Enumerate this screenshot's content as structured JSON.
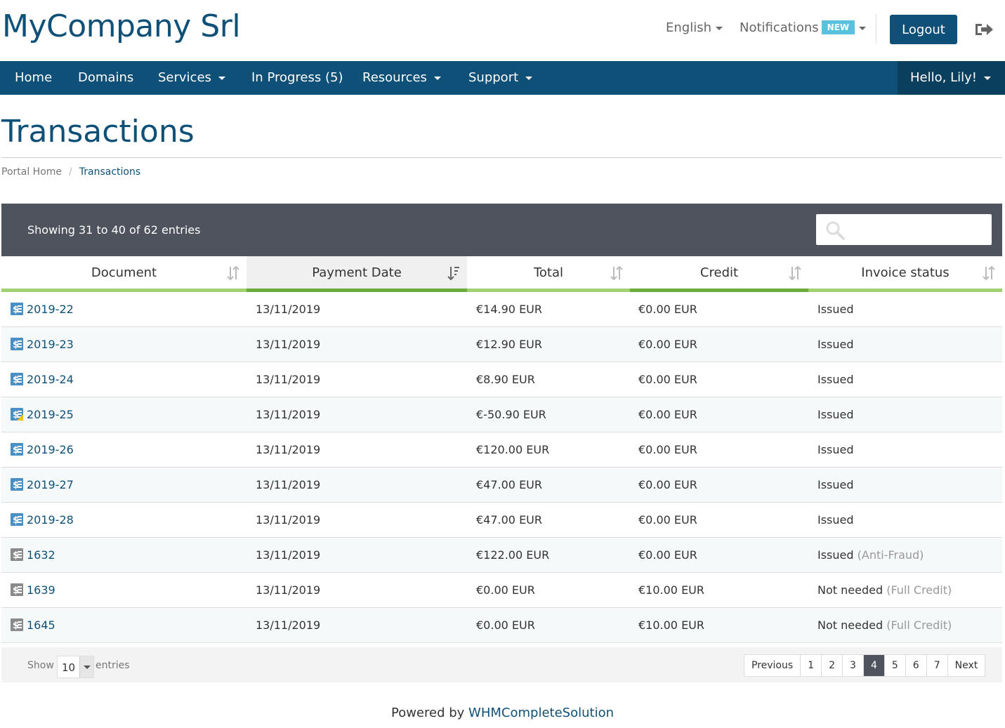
{
  "header": {
    "company": "MyCompany Srl",
    "language": "English",
    "notifications": "Notifications",
    "notifications_badge": "NEW",
    "logout": "Logout"
  },
  "nav": {
    "home": "Home",
    "domains": "Domains",
    "services": "Services",
    "in_progress": "In Progress (5)",
    "resources": "Resources",
    "support": "Support",
    "user": "Hello, Lily!"
  },
  "page": {
    "title": "Transactions",
    "breadcrumb": [
      "Portal Home",
      "Transactions"
    ]
  },
  "table": {
    "showing": "Showing 31 to 40 of 62 entries",
    "columns": [
      "Document",
      "Payment Date",
      "Total",
      "Credit",
      "Invoice status"
    ],
    "rows": [
      {
        "doc": "2019-22",
        "date": "13/11/2019",
        "total": "€14.90 EUR",
        "credit": "€0.00 EUR",
        "status": "Issued",
        "note": "",
        "icon": "invoice-blue-icon"
      },
      {
        "doc": "2019-23",
        "date": "13/11/2019",
        "total": "€12.90 EUR",
        "credit": "€0.00 EUR",
        "status": "Issued",
        "note": "",
        "icon": "invoice-blue-icon"
      },
      {
        "doc": "2019-24",
        "date": "13/11/2019",
        "total": "€8.90 EUR",
        "credit": "€0.00 EUR",
        "status": "Issued",
        "note": "",
        "icon": "invoice-blue-icon"
      },
      {
        "doc": "2019-25",
        "date": "13/11/2019",
        "total": "€-50.90 EUR",
        "credit": "€0.00 EUR",
        "status": "Issued",
        "note": "",
        "icon": "credit-note-icon"
      },
      {
        "doc": "2019-26",
        "date": "13/11/2019",
        "total": "€120.00 EUR",
        "credit": "€0.00 EUR",
        "status": "Issued",
        "note": "",
        "icon": "invoice-blue-icon"
      },
      {
        "doc": "2019-27",
        "date": "13/11/2019",
        "total": "€47.00 EUR",
        "credit": "€0.00 EUR",
        "status": "Issued",
        "note": "",
        "icon": "invoice-blue-icon"
      },
      {
        "doc": "2019-28",
        "date": "13/11/2019",
        "total": "€47.00 EUR",
        "credit": "€0.00 EUR",
        "status": "Issued",
        "note": "",
        "icon": "invoice-blue-icon"
      },
      {
        "doc": "1632",
        "date": "13/11/2019",
        "total": "€122.00 EUR",
        "credit": "€0.00 EUR",
        "status": "Issued",
        "note": "(Anti-Fraud)",
        "icon": "invoice-grey-icon"
      },
      {
        "doc": "1639",
        "date": "13/11/2019",
        "total": "€0.00 EUR",
        "credit": "€10.00 EUR",
        "status": "Not needed",
        "note": "(Full Credit)",
        "icon": "invoice-grey-icon"
      },
      {
        "doc": "1645",
        "date": "13/11/2019",
        "total": "€0.00 EUR",
        "credit": "€10.00 EUR",
        "status": "Not needed",
        "note": "(Full Credit)",
        "icon": "invoice-grey-icon"
      }
    ],
    "show_label": "Show",
    "show_value": "10",
    "entries_label": "entries",
    "pagination": [
      "Previous",
      "1",
      "2",
      "3",
      "4",
      "5",
      "6",
      "7",
      "Next"
    ],
    "active_page": "4"
  },
  "footer": {
    "powered_by": "Powered by",
    "link": "WHMCompleteSolution"
  },
  "colors": {
    "brand": "#0e5077",
    "table_bar": "#4e535e",
    "sort_underline": "#a0d070",
    "sort_underline_active": "#6aab3c"
  }
}
